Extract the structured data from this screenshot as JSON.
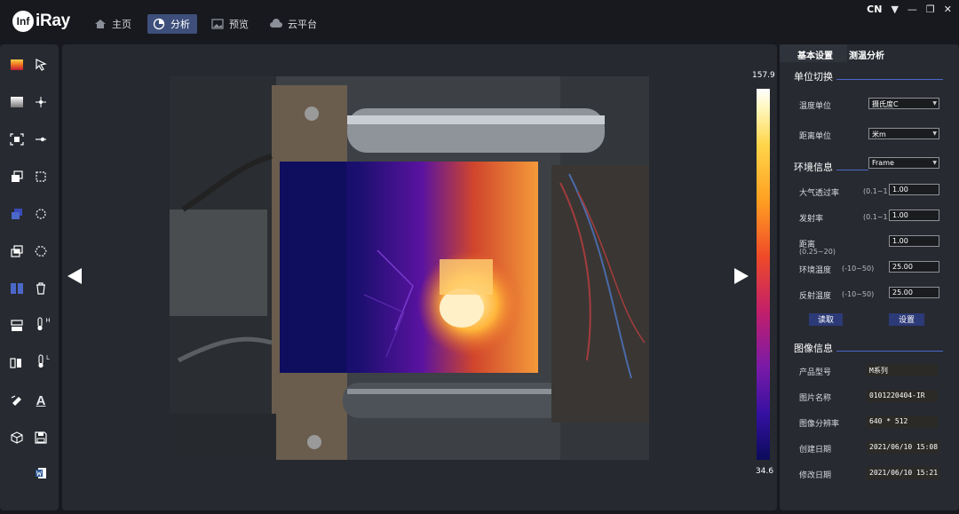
{
  "app": {
    "logo_badge": "Inf",
    "logo_text": "iRay"
  },
  "nav": {
    "items": [
      {
        "label": "主页",
        "icon": "home-icon"
      },
      {
        "label": "分析",
        "icon": "pie-chart-icon",
        "active": true
      },
      {
        "label": "预览",
        "icon": "image-icon"
      },
      {
        "label": "云平台",
        "icon": "cloud-icon"
      }
    ]
  },
  "window": {
    "lang": "CN",
    "lang_arrow": "▼",
    "minimize": "—",
    "restore": "❐",
    "close": "✕"
  },
  "colorbar": {
    "max": "157.9",
    "min": "34.6"
  },
  "tabs": {
    "basic": "基本设置",
    "analysis": "测温分析"
  },
  "unit_section": {
    "title": "单位切换",
    "temp_label": "温度单位",
    "temp_value": "摄氏度C",
    "dist_label": "距离单位",
    "dist_value": "米m"
  },
  "env_section": {
    "title": "环境信息",
    "mode_value": "Frame",
    "transmittance_label": "大气透过率",
    "transmittance_range": "(0.1~1",
    "transmittance_value": "1.00",
    "emissivity_label": "发射率",
    "emissivity_range": "(0.1~1",
    "emissivity_value": "1.00",
    "distance_label": "距离",
    "distance_range": "(0.25~20)",
    "distance_value": "1.00",
    "ambient_label": "环境温度",
    "ambient_range": "(-10~50)",
    "ambient_value": "25.00",
    "reflect_label": "反射温度",
    "reflect_range": "(-10~50)",
    "reflect_value": "25.00",
    "read_button": "读取",
    "set_button": "设置"
  },
  "image_section": {
    "title": "图像信息",
    "model_label": "产品型号",
    "model_value": "M系列",
    "name_label": "图片名称",
    "name_value": "0101220404-IR",
    "res_label": "图像分辨率",
    "res_value": "640 * 512",
    "created_label": "创建日期",
    "created_value": "2021/06/10 15:08",
    "modified_label": "修改日期",
    "modified_value": "2021/06/10 15:21"
  },
  "tool_labels": {
    "thermo_high": "H",
    "thermo_low": "L",
    "text_tool": "A"
  },
  "accent": "#4b68c9",
  "active_nav_color": "#3d4f7a"
}
